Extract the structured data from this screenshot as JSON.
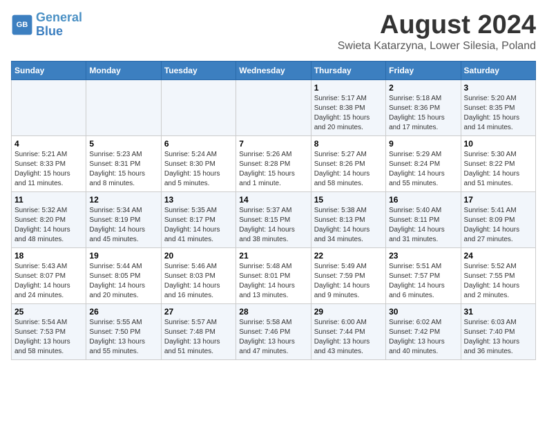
{
  "header": {
    "logo_line1": "General",
    "logo_line2": "Blue",
    "main_title": "August 2024",
    "subtitle": "Swieta Katarzyna, Lower Silesia, Poland"
  },
  "weekdays": [
    "Sunday",
    "Monday",
    "Tuesday",
    "Wednesday",
    "Thursday",
    "Friday",
    "Saturday"
  ],
  "weeks": [
    [
      {
        "day": "",
        "info": ""
      },
      {
        "day": "",
        "info": ""
      },
      {
        "day": "",
        "info": ""
      },
      {
        "day": "",
        "info": ""
      },
      {
        "day": "1",
        "info": "Sunrise: 5:17 AM\nSunset: 8:38 PM\nDaylight: 15 hours\nand 20 minutes."
      },
      {
        "day": "2",
        "info": "Sunrise: 5:18 AM\nSunset: 8:36 PM\nDaylight: 15 hours\nand 17 minutes."
      },
      {
        "day": "3",
        "info": "Sunrise: 5:20 AM\nSunset: 8:35 PM\nDaylight: 15 hours\nand 14 minutes."
      }
    ],
    [
      {
        "day": "4",
        "info": "Sunrise: 5:21 AM\nSunset: 8:33 PM\nDaylight: 15 hours\nand 11 minutes."
      },
      {
        "day": "5",
        "info": "Sunrise: 5:23 AM\nSunset: 8:31 PM\nDaylight: 15 hours\nand 8 minutes."
      },
      {
        "day": "6",
        "info": "Sunrise: 5:24 AM\nSunset: 8:30 PM\nDaylight: 15 hours\nand 5 minutes."
      },
      {
        "day": "7",
        "info": "Sunrise: 5:26 AM\nSunset: 8:28 PM\nDaylight: 15 hours\nand 1 minute."
      },
      {
        "day": "8",
        "info": "Sunrise: 5:27 AM\nSunset: 8:26 PM\nDaylight: 14 hours\nand 58 minutes."
      },
      {
        "day": "9",
        "info": "Sunrise: 5:29 AM\nSunset: 8:24 PM\nDaylight: 14 hours\nand 55 minutes."
      },
      {
        "day": "10",
        "info": "Sunrise: 5:30 AM\nSunset: 8:22 PM\nDaylight: 14 hours\nand 51 minutes."
      }
    ],
    [
      {
        "day": "11",
        "info": "Sunrise: 5:32 AM\nSunset: 8:20 PM\nDaylight: 14 hours\nand 48 minutes."
      },
      {
        "day": "12",
        "info": "Sunrise: 5:34 AM\nSunset: 8:19 PM\nDaylight: 14 hours\nand 45 minutes."
      },
      {
        "day": "13",
        "info": "Sunrise: 5:35 AM\nSunset: 8:17 PM\nDaylight: 14 hours\nand 41 minutes."
      },
      {
        "day": "14",
        "info": "Sunrise: 5:37 AM\nSunset: 8:15 PM\nDaylight: 14 hours\nand 38 minutes."
      },
      {
        "day": "15",
        "info": "Sunrise: 5:38 AM\nSunset: 8:13 PM\nDaylight: 14 hours\nand 34 minutes."
      },
      {
        "day": "16",
        "info": "Sunrise: 5:40 AM\nSunset: 8:11 PM\nDaylight: 14 hours\nand 31 minutes."
      },
      {
        "day": "17",
        "info": "Sunrise: 5:41 AM\nSunset: 8:09 PM\nDaylight: 14 hours\nand 27 minutes."
      }
    ],
    [
      {
        "day": "18",
        "info": "Sunrise: 5:43 AM\nSunset: 8:07 PM\nDaylight: 14 hours\nand 24 minutes."
      },
      {
        "day": "19",
        "info": "Sunrise: 5:44 AM\nSunset: 8:05 PM\nDaylight: 14 hours\nand 20 minutes."
      },
      {
        "day": "20",
        "info": "Sunrise: 5:46 AM\nSunset: 8:03 PM\nDaylight: 14 hours\nand 16 minutes."
      },
      {
        "day": "21",
        "info": "Sunrise: 5:48 AM\nSunset: 8:01 PM\nDaylight: 14 hours\nand 13 minutes."
      },
      {
        "day": "22",
        "info": "Sunrise: 5:49 AM\nSunset: 7:59 PM\nDaylight: 14 hours\nand 9 minutes."
      },
      {
        "day": "23",
        "info": "Sunrise: 5:51 AM\nSunset: 7:57 PM\nDaylight: 14 hours\nand 6 minutes."
      },
      {
        "day": "24",
        "info": "Sunrise: 5:52 AM\nSunset: 7:55 PM\nDaylight: 14 hours\nand 2 minutes."
      }
    ],
    [
      {
        "day": "25",
        "info": "Sunrise: 5:54 AM\nSunset: 7:53 PM\nDaylight: 13 hours\nand 58 minutes."
      },
      {
        "day": "26",
        "info": "Sunrise: 5:55 AM\nSunset: 7:50 PM\nDaylight: 13 hours\nand 55 minutes."
      },
      {
        "day": "27",
        "info": "Sunrise: 5:57 AM\nSunset: 7:48 PM\nDaylight: 13 hours\nand 51 minutes."
      },
      {
        "day": "28",
        "info": "Sunrise: 5:58 AM\nSunset: 7:46 PM\nDaylight: 13 hours\nand 47 minutes."
      },
      {
        "day": "29",
        "info": "Sunrise: 6:00 AM\nSunset: 7:44 PM\nDaylight: 13 hours\nand 43 minutes."
      },
      {
        "day": "30",
        "info": "Sunrise: 6:02 AM\nSunset: 7:42 PM\nDaylight: 13 hours\nand 40 minutes."
      },
      {
        "day": "31",
        "info": "Sunrise: 6:03 AM\nSunset: 7:40 PM\nDaylight: 13 hours\nand 36 minutes."
      }
    ]
  ]
}
